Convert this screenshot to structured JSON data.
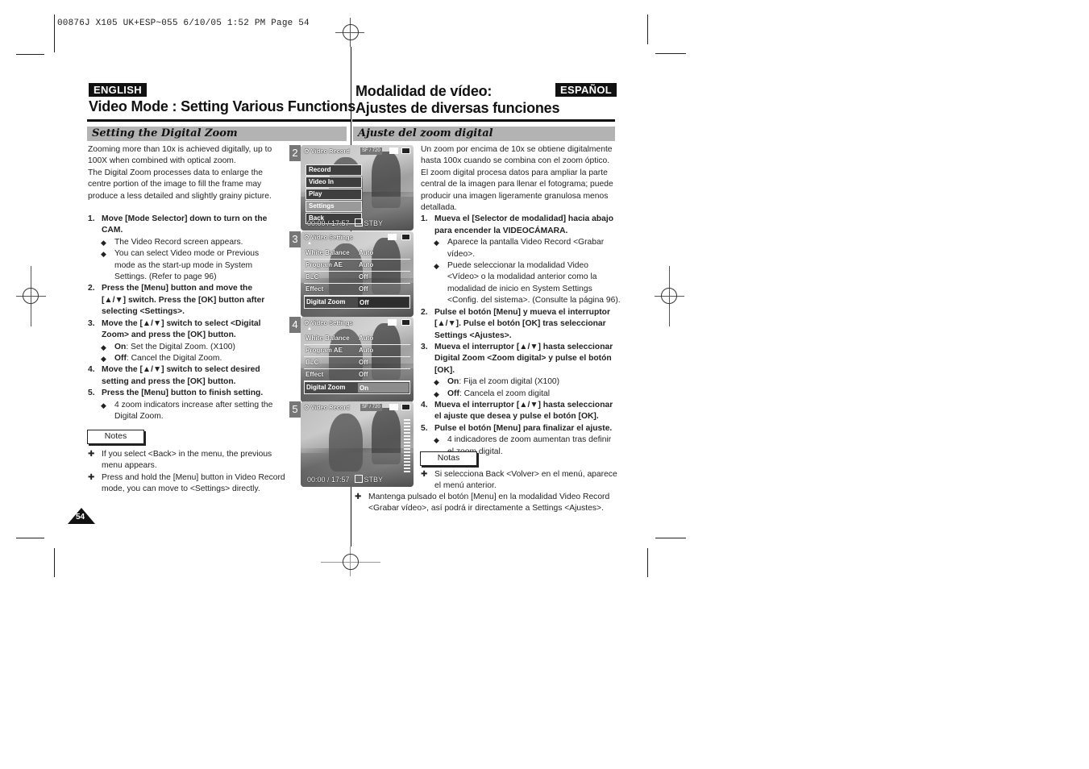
{
  "print_header": "00876J X105 UK+ESP~055   6/10/05 1:52 PM   Page 54",
  "english": {
    "lang_label": "ENGLISH",
    "title": "Video Mode : Setting Various Functions",
    "section": "Setting the Digital Zoom",
    "intro": [
      "Zooming more than 10x is achieved digitally, up to",
      "100X when combined with optical zoom.",
      "The Digital Zoom processes data to enlarge the",
      "centre portion of the image to fill the frame may",
      "produce a less detailed and slightly grainy picture."
    ],
    "steps": [
      {
        "num": "1.",
        "lines": [
          "Move [Mode Selector] down to turn on the",
          "CAM."
        ],
        "bullets": [
          {
            "lines": [
              "The Video Record screen appears."
            ]
          },
          {
            "lines": [
              "You can select Video mode or Previous",
              "mode as the start-up mode in System",
              "Settings. (Refer to page 96)"
            ]
          }
        ]
      },
      {
        "num": "2.",
        "lines": [
          "Press the [Menu] button and move the",
          "[▲/▼] switch. Press the [OK] button after",
          "selecting <Settings>."
        ],
        "bullets": []
      },
      {
        "num": "3.",
        "lines": [
          "Move the [▲/▼] switch to select <Digital",
          "Zoom> and press the [OK] button."
        ],
        "bullets": [
          {
            "bold": "On",
            "rest": ": Set the Digital Zoom. (X100)"
          },
          {
            "bold": "Off",
            "rest": ": Cancel the Digital Zoom."
          }
        ]
      },
      {
        "num": "4.",
        "lines": [
          "Move the [▲/▼] switch to select desired",
          "setting and press the [OK] button."
        ],
        "bullets": []
      },
      {
        "num": "5.",
        "lines": [
          "Press the [Menu] button to finish setting."
        ],
        "bullets": [
          {
            "lines": [
              "4 zoom indicators increase after setting the",
              "Digital Zoom."
            ]
          }
        ]
      }
    ],
    "notes_label": "Notes",
    "notes": [
      [
        "If you select <Back> in the menu, the previous",
        "menu appears."
      ],
      [
        "Press and hold the [Menu] button in Video Record",
        "mode, you can move to <Settings> directly."
      ]
    ],
    "page_number": "54"
  },
  "spanish": {
    "lang_label": "ESPAÑOL",
    "title_line1": "Modalidad de vídeo:",
    "title_line2": "Ajustes de diversas funciones",
    "section": "Ajuste del zoom digital",
    "intro": [
      "Un zoom por encima de 10x se obtiene digitalmente",
      "hasta 100x cuando se combina con el zoom óptico.",
      "El zoom digital procesa datos para ampliar la parte",
      "central de la imagen para llenar el fotograma; puede",
      "producir una imagen ligeramente granulosa menos",
      "detallada."
    ],
    "steps": [
      {
        "num": "1.",
        "lines": [
          "Mueva el [Selector de modalidad] hacia abajo",
          "para encender la VIDEOCÁMARA."
        ],
        "bullets": [
          {
            "lines": [
              "Aparece la pantalla Video Record <Grabar",
              "vídeo>."
            ]
          },
          {
            "lines": [
              "Puede seleccionar la modalidad Video",
              "<Vídeo> o la modalidad anterior como la",
              "modalidad de inicio en System Settings",
              "<Config. del sistema>. (Consulte la página 96)."
            ]
          }
        ]
      },
      {
        "num": "2.",
        "lines": [
          "Pulse el botón [Menu] y mueva el interruptor",
          "[▲/▼]. Pulse el botón [OK] tras seleccionar",
          "Settings <Ajustes>."
        ],
        "bullets": []
      },
      {
        "num": "3.",
        "lines": [
          "Mueva el interruptor [▲/▼] hasta seleccionar",
          "Digital Zoom <Zoom digital> y pulse el botón",
          "[OK]."
        ],
        "bullets": [
          {
            "bold": "On",
            "rest": ": Fija el zoom digital (X100)"
          },
          {
            "bold": "Off",
            "rest": ": Cancela el zoom digital"
          }
        ]
      },
      {
        "num": "4.",
        "lines": [
          "Mueva el interruptor [▲/▼] hasta seleccionar",
          "el ajuste que desea y pulse el botón [OK]."
        ],
        "bullets": []
      },
      {
        "num": "5.",
        "lines": [
          "Pulse el botón [Menu] para finalizar el ajuste."
        ],
        "bullets": [
          {
            "lines": [
              "4 indicadores de zoom aumentan tras definir",
              "el zoom digital."
            ]
          }
        ]
      }
    ],
    "notes_label": "Notas",
    "notes": [
      [
        "Si selecciona Back <Volver> en el menú, aparece",
        "el menú anterior."
      ],
      [
        "Mantenga pulsado el botón [Menu] en la modalidad Video Record",
        "<Grabar vídeo>, así podrá ir directamente a Settings <Ajustes>."
      ]
    ]
  },
  "screens": [
    {
      "step": "2",
      "header": "Video Record",
      "badge": "SF / 720",
      "menu": [
        "Record",
        "Video In",
        "Play",
        "Settings",
        "Back"
      ],
      "selected": "Settings",
      "time": "00:00 / 17:57",
      "status": "STBY"
    },
    {
      "step": "3",
      "header": "Video Settings",
      "rows": [
        [
          "White Balance",
          "Auto"
        ],
        [
          "Program AE",
          "Auto"
        ],
        [
          "BLC",
          "Off"
        ],
        [
          "Effect",
          "Off"
        ]
      ],
      "highlight": [
        "Digital Zoom",
        "Off"
      ]
    },
    {
      "step": "4",
      "header": "Video Settings",
      "rows": [
        [
          "White Balance",
          "Auto"
        ],
        [
          "Program AE",
          "Auto"
        ],
        [
          "BLC",
          "Off"
        ],
        [
          "Effect",
          "Off"
        ]
      ],
      "highlight": [
        "Digital Zoom",
        "On"
      ]
    },
    {
      "step": "5",
      "header": "Video Record",
      "badge": "SF / 720",
      "time": "00:00 / 17:57",
      "status": "STBY"
    }
  ],
  "icons": {
    "bullet": "◆",
    "note_marker": "✚"
  }
}
